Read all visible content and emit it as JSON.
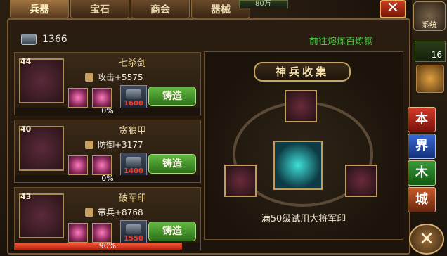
{
  "tabs": [
    {
      "label": "兵器",
      "active": true
    },
    {
      "label": "宝石",
      "active": false
    },
    {
      "label": "商会",
      "active": false
    },
    {
      "label": "器械",
      "active": false
    }
  ],
  "top_gold": "80万",
  "currency_value": "1366",
  "forge_link": "前往熔炼百炼钢",
  "items": [
    {
      "level": "44",
      "name": "七杀剑",
      "stat": "攻击+5575",
      "cost": "1600",
      "button": "铸造",
      "progress_text": "0%",
      "progress": 0
    },
    {
      "level": "40",
      "name": "贪狼甲",
      "stat": "防御+3177",
      "cost": "1400",
      "button": "铸造",
      "progress_text": "0%",
      "progress": 0
    },
    {
      "level": "43",
      "name": "破军印",
      "stat": "带兵+8768",
      "cost": "1550",
      "button": "铸造",
      "progress_text": "90%",
      "progress": 0.9
    }
  ],
  "collection": {
    "title": "神兵收集",
    "note": "满50级试用大将军印"
  },
  "sidebar": {
    "system_label": "系统",
    "rank": "16",
    "buttons": [
      "本",
      "界",
      "木",
      "城"
    ],
    "close_glyph": "✕",
    "bottom_glyph": "✕"
  },
  "colors": {
    "forge_button": "#4a9a30",
    "progress_fill": "#d8341a",
    "link_green": "#46d046",
    "cost_red": "#ff3a2a"
  },
  "icons": [
    "ingot-icon",
    "sword-icon",
    "armor-icon",
    "seal-icon",
    "gem-icon",
    "close-icon",
    "gear-icon",
    "lantern-icon"
  ]
}
